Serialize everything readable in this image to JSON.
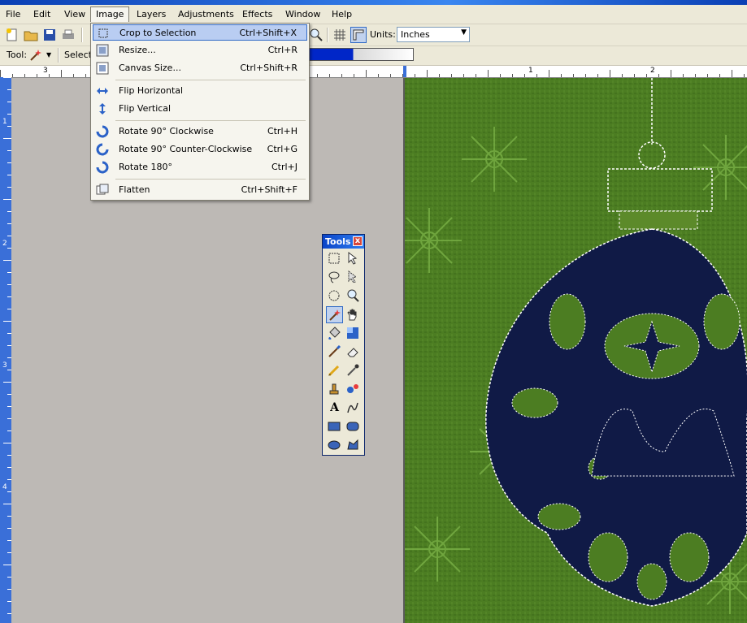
{
  "menubar": {
    "items": [
      "File",
      "Edit",
      "View",
      "Image",
      "Layers",
      "Adjustments",
      "Effects",
      "Window",
      "Help"
    ]
  },
  "toolbar": {
    "units_label": "Units:",
    "units_value": "Inches"
  },
  "toolbar2": {
    "tool_label": "Tool:",
    "selection_label": "Selectio",
    "percent_sign": "%"
  },
  "ruler": {
    "top_labels": [
      "3",
      "1",
      "2"
    ],
    "left_labels": [
      "1",
      "2",
      "3",
      "4"
    ]
  },
  "image_menu": {
    "items": [
      {
        "label": "Crop to Selection",
        "shortcut": "Ctrl+Shift+X",
        "icon": "crop-icon",
        "highlighted": true
      },
      {
        "label": "Resize...",
        "shortcut": "Ctrl+R",
        "icon": "resize-icon"
      },
      {
        "label": "Canvas Size...",
        "shortcut": "Ctrl+Shift+R",
        "icon": "canvas-size-icon"
      },
      {
        "label": "Flip Horizontal",
        "shortcut": "",
        "icon": "flip-horizontal-icon"
      },
      {
        "label": "Flip Vertical",
        "shortcut": "",
        "icon": "flip-vertical-icon"
      },
      {
        "label": "Rotate 90° Clockwise",
        "shortcut": "Ctrl+H",
        "icon": "rotate-cw-icon"
      },
      {
        "label": "Rotate 90° Counter-Clockwise",
        "shortcut": "Ctrl+G",
        "icon": "rotate-ccw-icon"
      },
      {
        "label": "Rotate 180°",
        "shortcut": "Ctrl+J",
        "icon": "rotate-180-icon"
      },
      {
        "label": "Flatten",
        "shortcut": "Ctrl+Shift+F",
        "icon": "flatten-icon"
      }
    ]
  },
  "tools_window": {
    "title": "Tools",
    "close": "x",
    "text_tool_glyph": "A",
    "tools": [
      "rectangle-select-icon",
      "move-selection-icon",
      "lasso-select-icon",
      "move-selected-icon",
      "ellipse-select-icon",
      "zoom-icon",
      "magic-wand-icon",
      "pan-icon",
      "paint-bucket-icon",
      "gradient-icon",
      "paintbrush-icon",
      "eraser-icon",
      "pencil-icon",
      "color-picker-icon",
      "clone-stamp-icon",
      "recolor-icon",
      "text-icon",
      "line-curve-icon",
      "rectangle-icon",
      "rounded-rectangle-icon",
      "ellipse-icon",
      "freeform-shape-icon"
    ],
    "active_tool": "magic-wand-icon"
  },
  "colors": {
    "accent": "#316ac5",
    "canvas_green": "#4c7d22",
    "ornament_navy": "#101a46"
  }
}
